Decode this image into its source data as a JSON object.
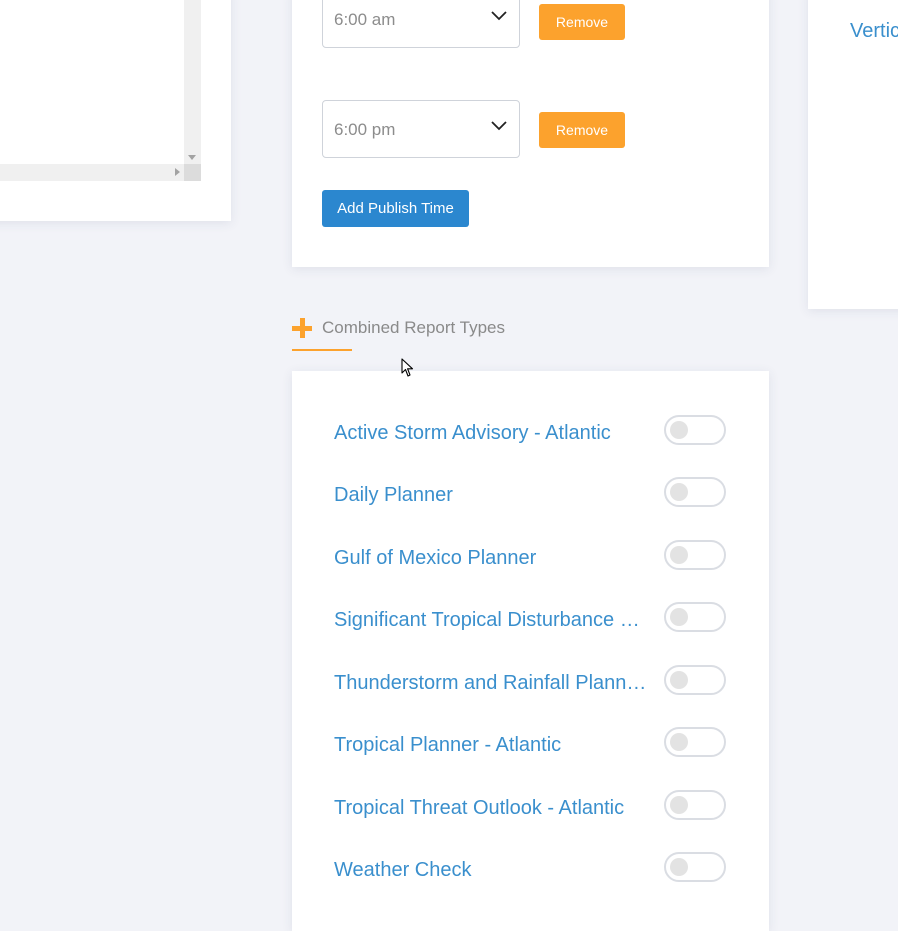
{
  "publish_times": {
    "times": [
      {
        "value": "6:00 am",
        "remove_label": "Remove"
      },
      {
        "value": "6:00 pm",
        "remove_label": "Remove"
      }
    ],
    "add_label": "Add Publish Time"
  },
  "right_card": {
    "link_text": "Vertic"
  },
  "combined": {
    "title": "Combined Report Types",
    "items": [
      {
        "label": "Active Storm Advisory - Atlantic",
        "enabled": false
      },
      {
        "label": "Daily Planner",
        "enabled": false
      },
      {
        "label": "Gulf of Mexico Planner",
        "enabled": false
      },
      {
        "label": "Significant Tropical Disturbance …",
        "enabled": false
      },
      {
        "label": "Thunderstorm and Rainfall Plann…",
        "enabled": false
      },
      {
        "label": "Tropical Planner - Atlantic",
        "enabled": false
      },
      {
        "label": "Tropical Threat Outlook - Atlantic",
        "enabled": false
      },
      {
        "label": "Weather Check",
        "enabled": false
      }
    ]
  },
  "colors": {
    "accent_orange": "#fca22d",
    "link_blue": "#3a8fcd",
    "primary_blue": "#2b87cf",
    "background": "#f2f3f8"
  },
  "icons": {
    "select_chevron": "chevron-down-icon",
    "section_icon": "plus-icon",
    "cursor": "mouse-pointer-icon"
  }
}
